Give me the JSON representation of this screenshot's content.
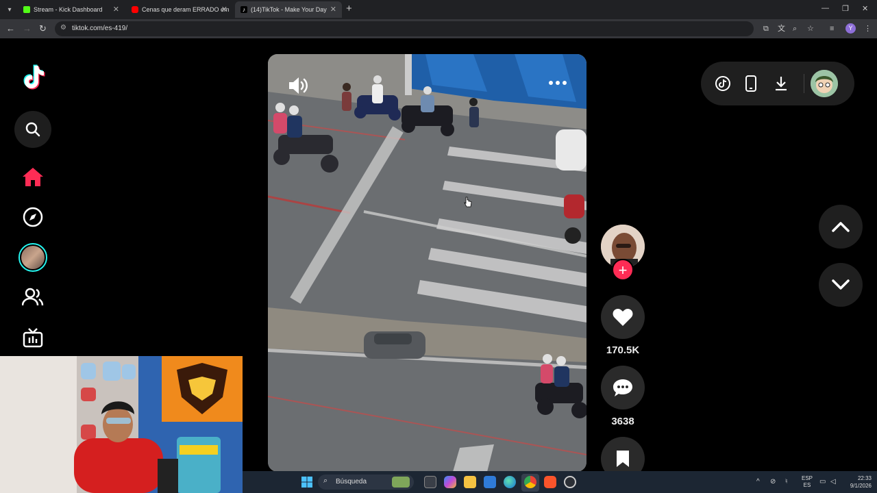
{
  "browser": {
    "tabs": [
      {
        "title": "Stream - Kick Dashboard",
        "favicon_color": "#53fc18"
      },
      {
        "title": "Cenas que deram ERRADO em",
        "favicon_color": "#ff0000"
      },
      {
        "title": "(14)TikTok - Make Your Day",
        "favicon_color": "#ffffff"
      }
    ],
    "url": "tiktok.com/es-419/"
  },
  "tiktok": {
    "accent_color": "#fe2c55",
    "likes_count": "170.5K",
    "comments_count": "3638"
  },
  "taskbar": {
    "search_label": "Búsqueda",
    "language": "ESP",
    "region": "ES",
    "time": "22:33",
    "date": "9/1/2026"
  }
}
